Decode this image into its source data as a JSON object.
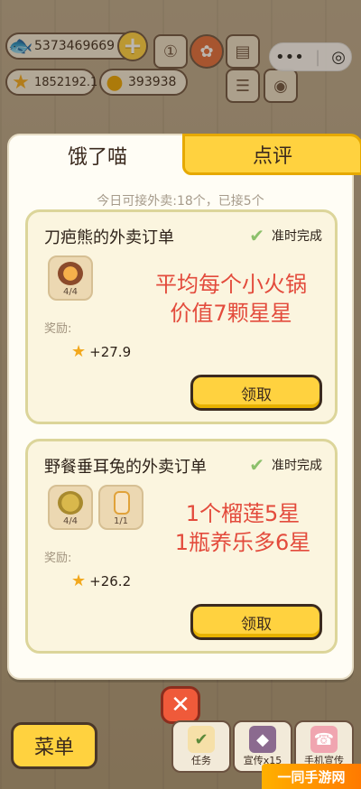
{
  "resources": {
    "fish_count": "5373469669",
    "star_count": "1852192.1",
    "coin_count": "393938"
  },
  "top_icons": [
    "rank-icon",
    "cookie-icon",
    "book-icon",
    "news-icon",
    "gamepad-icon"
  ],
  "capsule": {
    "more": "•••",
    "close": "◎"
  },
  "panel": {
    "tabs": [
      {
        "label": "饿了喵",
        "active": false
      },
      {
        "label": "点评",
        "active": true
      }
    ],
    "subtitle": "今日可接外卖:18个，已接5个",
    "orders": [
      {
        "title": "刀疤熊的外卖订单",
        "status": "准时完成",
        "items": [
          {
            "icon": "hotpot-icon",
            "qty": "4/4"
          }
        ],
        "note_lines": [
          "平均每个小火锅",
          "价值7颗星星"
        ],
        "reward_label": "奖励:",
        "reward": "+27.9",
        "claim_label": "领取"
      },
      {
        "title": "野餐垂耳兔的外卖订单",
        "status": "准时完成",
        "items": [
          {
            "icon": "durian-icon",
            "qty": "4/4"
          },
          {
            "icon": "yakult-icon",
            "qty": "1/1"
          }
        ],
        "note_lines": [
          "1个榴莲5星",
          "1瓶养乐多6星"
        ],
        "reward_label": "奖励:",
        "reward": "+26.2",
        "claim_label": "领取"
      }
    ]
  },
  "close_label": "✕",
  "bottom": {
    "menu_label": "菜单",
    "buttons": [
      {
        "label": "任务",
        "icon": "clipboard-icon"
      },
      {
        "label": "宣传x15",
        "icon": "megaphone-icon"
      },
      {
        "label": "手机宣传",
        "icon": "phone-icon"
      }
    ]
  },
  "watermark": "一同手游网",
  "colors": {
    "accent_yellow": "#ffd23f",
    "note_red": "#e34b3c",
    "check_green": "#8cc06b"
  }
}
